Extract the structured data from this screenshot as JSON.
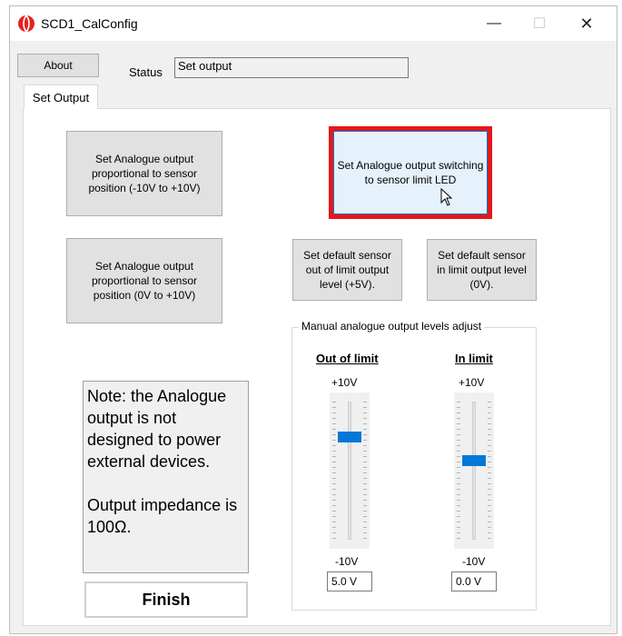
{
  "window": {
    "title": "SCD1_CalConfig",
    "controls": {
      "minimize": "—",
      "maximize": "☐",
      "close": "✕"
    }
  },
  "toolbar": {
    "about_label": "About",
    "status_label": "Status",
    "status_value": "Set output"
  },
  "tabs": [
    {
      "label": "Set Output",
      "active": true
    }
  ],
  "buttons": {
    "analogue_pm10": "Set Analogue output proportional to sensor position (-10V to +10V)",
    "analogue_0_10": "Set Analogue output proportional to sensor position (0V to +10V)",
    "analogue_limit_led": "Set Analogue output switching to sensor limit LED",
    "default_out_of_limit": "Set default sensor out of limit output level (+5V).",
    "default_in_limit": "Set default sensor in limit output level (0V).",
    "finish": "Finish"
  },
  "manual_adjust": {
    "title": "Manual analogue output levels adjust",
    "out_of_limit": {
      "heading": "Out of limit",
      "max_label": "+10V",
      "min_label": "-10V",
      "value": "5.0 V",
      "level": 5.0
    },
    "in_limit": {
      "heading": "In limit",
      "max_label": "+10V",
      "min_label": "-10V",
      "value": "0.0 V",
      "level": 0.0
    }
  },
  "note": {
    "line1": "Note: the Analogue output is not designed to power external devices.",
    "line2": "Output impedance is 100Ω."
  },
  "colors": {
    "highlight_border": "#e8161a",
    "slider_thumb": "#0078d7",
    "app_icon": "#e32420"
  },
  "icons": {
    "app": "app-logo-icon",
    "cursor": "mouse-pointer-icon"
  }
}
